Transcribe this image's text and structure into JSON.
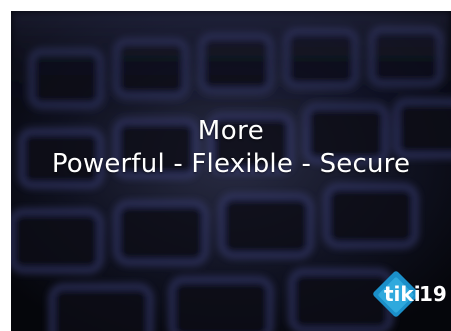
{
  "slide": {
    "headline_line1": "More",
    "headline_line2": "Powerful - Flexible - Secure"
  },
  "logo": {
    "brand": "tiki",
    "version": "19"
  },
  "colors": {
    "background": "#07080d",
    "text": "#ffffff",
    "logo_blue": "#1b8fc9",
    "logo_light_blue": "#33aee0"
  },
  "icons": {
    "background": "blurred-keyboard-image",
    "logo": "tiki-logo-icon"
  }
}
